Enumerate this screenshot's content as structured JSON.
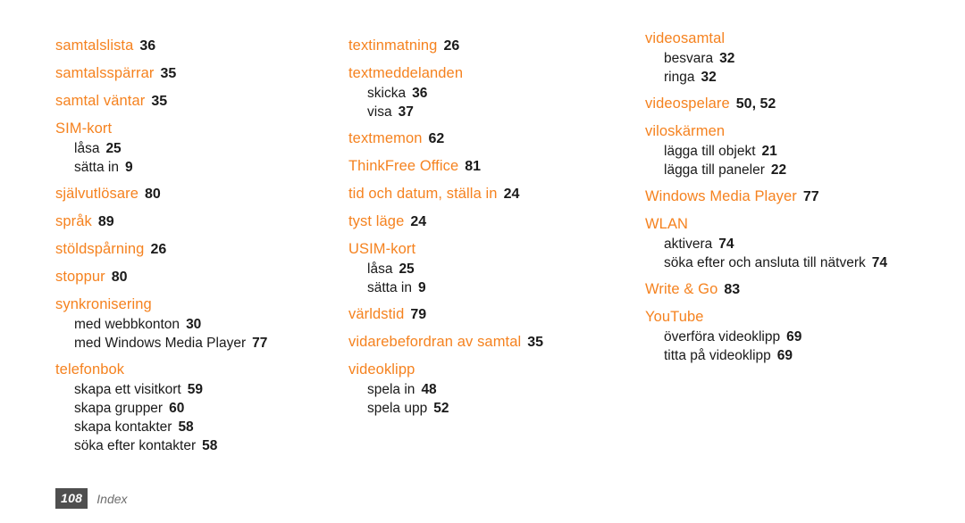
{
  "document": {
    "type": "index-page",
    "language": "sv",
    "accent_color": "#F5821F",
    "text_color": "#1a1a1a",
    "background_color": "#ffffff"
  },
  "footer": {
    "page_number": "108",
    "label": "Index",
    "box_color": "#4f4f4f",
    "label_color": "#6d6d6d"
  },
  "columns": [
    {
      "id": "column-1",
      "entries": [
        {
          "term": "samtalslista",
          "page": "36",
          "subs": []
        },
        {
          "term": "samtalsspärrar",
          "page": "35",
          "subs": []
        },
        {
          "term": "samtal väntar",
          "page": "35",
          "subs": []
        },
        {
          "term": "SIM-kort",
          "page": "",
          "subs": [
            {
              "term": "låsa",
              "page": "25"
            },
            {
              "term": "sätta in",
              "page": "9"
            }
          ]
        },
        {
          "term": "självutlösare",
          "page": "80",
          "subs": []
        },
        {
          "term": "språk",
          "page": "89",
          "subs": []
        },
        {
          "term": "stöldspårning",
          "page": "26",
          "subs": []
        },
        {
          "term": "stoppur",
          "page": "80",
          "subs": []
        },
        {
          "term": "synkronisering",
          "page": "",
          "subs": [
            {
              "term": "med webbkonton",
              "page": "30"
            },
            {
              "term": "med Windows Media Player",
              "page": "77"
            }
          ]
        },
        {
          "term": "telefonbok",
          "page": "",
          "subs": [
            {
              "term": "skapa ett visitkort",
              "page": "59"
            },
            {
              "term": "skapa grupper",
              "page": "60"
            },
            {
              "term": "skapa kontakter",
              "page": "58"
            },
            {
              "term": "söka efter kontakter",
              "page": "58"
            }
          ]
        }
      ]
    },
    {
      "id": "column-2",
      "entries": [
        {
          "term": "textinmatning",
          "page": "26",
          "subs": []
        },
        {
          "term": "textmeddelanden",
          "page": "",
          "subs": [
            {
              "term": "skicka",
              "page": "36"
            },
            {
              "term": "visa",
              "page": "37"
            }
          ]
        },
        {
          "term": "textmemon",
          "page": "62",
          "subs": []
        },
        {
          "term": "ThinkFree Office",
          "page": "81",
          "subs": []
        },
        {
          "term": "tid och datum, ställa in",
          "page": "24",
          "subs": []
        },
        {
          "term": "tyst läge",
          "page": "24",
          "subs": []
        },
        {
          "term": "USIM-kort",
          "page": "",
          "subs": [
            {
              "term": "låsa",
              "page": "25"
            },
            {
              "term": "sätta in",
              "page": "9"
            }
          ]
        },
        {
          "term": "världstid",
          "page": "79",
          "subs": []
        },
        {
          "term": "vidarebefordran av samtal",
          "page": "35",
          "subs": []
        },
        {
          "term": "videoklipp",
          "page": "",
          "subs": [
            {
              "term": "spela in",
              "page": "48"
            },
            {
              "term": "spela upp",
              "page": "52"
            }
          ]
        }
      ]
    },
    {
      "id": "column-3",
      "entries": [
        {
          "term": "videosamtal",
          "page": "",
          "subs": [
            {
              "term": "besvara",
              "page": "32"
            },
            {
              "term": "ringa",
              "page": "32"
            }
          ]
        },
        {
          "term": "videospelare",
          "page": "50, 52",
          "subs": []
        },
        {
          "term": "viloskärmen",
          "page": "",
          "subs": [
            {
              "term": "lägga till objekt",
              "page": "21"
            },
            {
              "term": "lägga till paneler",
              "page": "22"
            }
          ]
        },
        {
          "term": "Windows Media Player",
          "page": "77",
          "subs": []
        },
        {
          "term": "WLAN",
          "page": "",
          "subs": [
            {
              "term": "aktivera",
              "page": "74"
            },
            {
              "term": "söka efter och ansluta till nätverk",
              "page": "74",
              "wrap": true
            }
          ]
        },
        {
          "term": "Write & Go",
          "page": "83",
          "subs": []
        },
        {
          "term": "YouTube",
          "page": "",
          "subs": [
            {
              "term": "överföra videoklipp",
              "page": "69"
            },
            {
              "term": "titta på videoklipp",
              "page": "69"
            }
          ]
        }
      ]
    }
  ]
}
